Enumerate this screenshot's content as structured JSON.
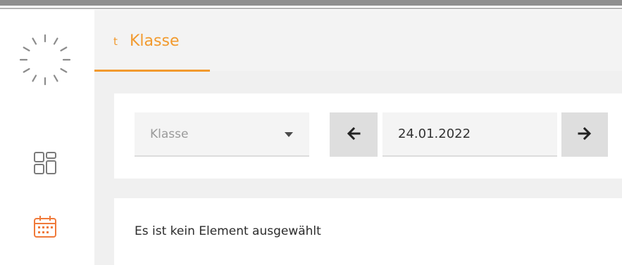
{
  "app": {
    "logo_icon": "spinner-logo-icon"
  },
  "sidebar": {
    "items": [
      {
        "icon": "dashboard-icon",
        "active": false
      },
      {
        "icon": "calendar-icon",
        "active": true
      }
    ],
    "accent_color": "#f29a2e"
  },
  "tabs": [
    {
      "prefix": "t",
      "label": "Klasse",
      "active": true
    }
  ],
  "filters": {
    "class_select": {
      "value": "Klasse"
    },
    "prev_icon": "arrow-left-icon",
    "date": {
      "value": "24.01.2022"
    },
    "next_icon": "arrow-right-icon"
  },
  "content": {
    "empty_message": "Es ist kein Element ausgewählt"
  },
  "colors": {
    "accent": "#f29a2e",
    "panel_bg": "#f0f0f0",
    "field_bg": "#f4f4f4",
    "button_bg": "#dedede"
  }
}
